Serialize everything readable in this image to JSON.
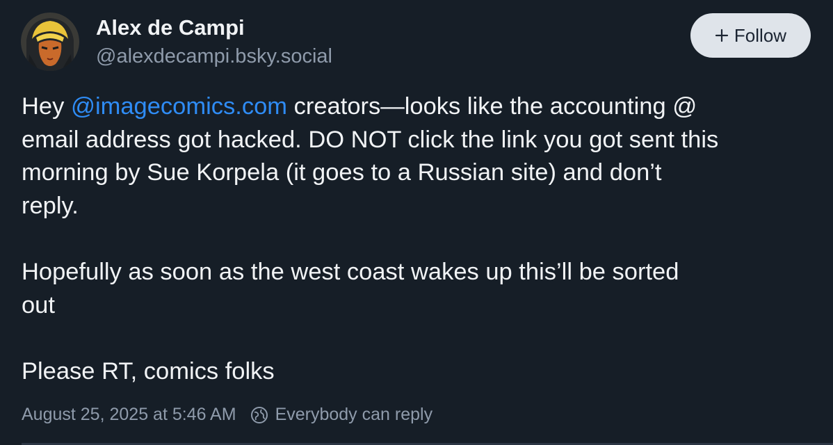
{
  "author": {
    "display_name": "Alex de Campi",
    "handle": "@alexdecampi.bsky.social",
    "avatar_icon": "avatar-illustration"
  },
  "follow_button": {
    "icon": "plus-icon",
    "label": "Follow"
  },
  "post": {
    "line1_pre": "Hey ",
    "mention": "@imagecomics.com",
    "line1_post": " creators—looks like the accounting @",
    "line2": "email address got hacked. DO NOT click the link you got sent this",
    "line3": "morning by Sue Korpela (it goes to a Russian site) and don’t",
    "line4": "reply.",
    "paragraph2_line1": "Hopefully as soon as the west coast wakes up this’ll be sorted",
    "paragraph2_line2": "out",
    "paragraph3": "Please RT, comics folks"
  },
  "meta": {
    "timestamp": "August 25, 2025 at 5:46 AM",
    "reply_icon": "globe-icon",
    "reply_setting": "Everybody can reply"
  },
  "colors": {
    "background": "#161e27",
    "text": "#f1f3f5",
    "muted": "#8f9bab",
    "link": "#2f8cf5",
    "button_bg": "#dfe4ea"
  }
}
